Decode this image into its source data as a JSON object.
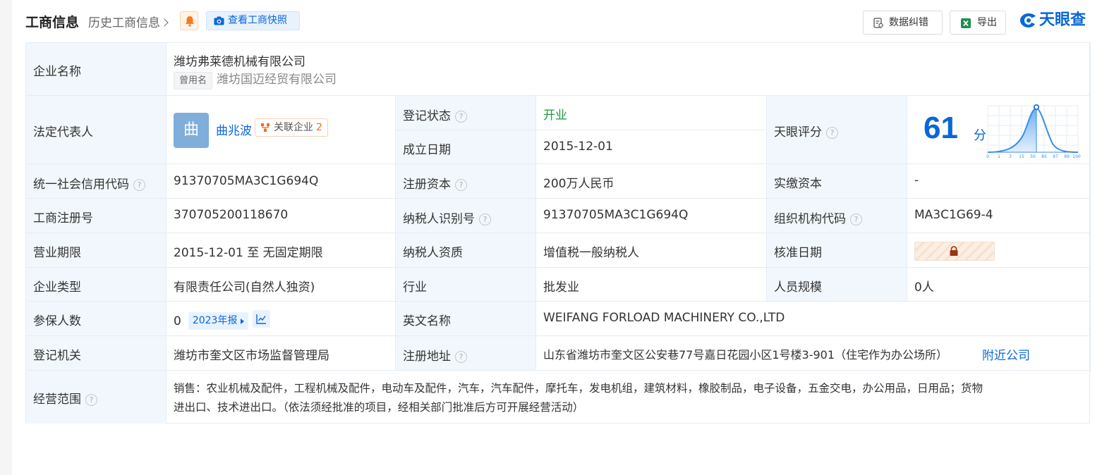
{
  "header": {
    "title": "工商信息",
    "history_link": "历史工商信息",
    "snapshot_button": "查看工商快照",
    "correct_button": "数据纠错",
    "export_button": "导出",
    "logo_text": "天眼查"
  },
  "colors": {
    "accent": "#0a67d8",
    "label_bg": "#f2f7fd",
    "status_green": "#1f9a3c",
    "tag_orange": "#f06c1e"
  },
  "rows": {
    "company_name": {
      "label": "企业名称",
      "value": "潍坊弗莱德机械有限公司",
      "used_tag": "曾用名",
      "used_name": "潍坊国迈经贸有限公司"
    },
    "legal_rep": {
      "label": "法定代表人",
      "avatar_char": "曲",
      "name": "曲兆波",
      "related_label": "关联企业",
      "related_count": "2"
    },
    "reg_status": {
      "label": "登记状态",
      "value": "开业"
    },
    "found_date": {
      "label": "成立日期",
      "value": "2015-12-01"
    },
    "tianyan_score": {
      "label": "天眼评分",
      "value": "61",
      "unit": "分",
      "ticks": [
        "0",
        "1",
        "3",
        "15",
        "50",
        "85",
        "97",
        "99",
        "100"
      ]
    },
    "credit_code": {
      "label": "统一社会信用代码",
      "value": "91370705MA3C1G694Q"
    },
    "reg_capital": {
      "label": "注册资本",
      "value": "200万人民币"
    },
    "paid_capital": {
      "label": "实缴资本",
      "value": "-"
    },
    "reg_number": {
      "label": "工商注册号",
      "value": "370705200118670"
    },
    "taxpayer_id": {
      "label": "纳税人识别号",
      "value": "91370705MA3C1G694Q"
    },
    "org_code": {
      "label": "组织机构代码",
      "value": "MA3C1G69-4"
    },
    "biz_term": {
      "label": "营业期限",
      "value": "2015-12-01 至 无固定期限"
    },
    "taxpayer_qual": {
      "label": "纳税人资质",
      "value": "增值税一般纳税人"
    },
    "approval_date": {
      "label": "核准日期",
      "value_locked": true,
      "icon": "lock-icon"
    },
    "company_type": {
      "label": "企业类型",
      "value": "有限责任公司(自然人独资)"
    },
    "industry": {
      "label": "行业",
      "value": "批发业"
    },
    "staff_size": {
      "label": "人员规模",
      "value": "0人"
    },
    "insured": {
      "label": "参保人数",
      "value": "0",
      "year_tag": "2023年报"
    },
    "english_name": {
      "label": "英文名称",
      "value": "WEIFANG FORLOAD MACHINERY CO.,LTD"
    },
    "reg_authority": {
      "label": "登记机关",
      "value": "潍坊市奎文区市场监督管理局"
    },
    "reg_address": {
      "label": "注册地址",
      "value": "山东省潍坊市奎文区公安巷77号嘉日花园小区1号楼3-901（住宅作为办公场所）",
      "nearby_link": "附近公司"
    },
    "biz_scope": {
      "label": "经营范围",
      "line1": "销售：农业机械及配件，工程机械及配件，电动车及配件，汽车，汽车配件，摩托车，发电机组，建筑材料，橡胶制品，电子设备，五金交电，办公用品，日用品；货物",
      "line2": "进出口、技术进出口。（依法须经批准的项目，经相关部门批准后方可开展经营活动）"
    }
  }
}
